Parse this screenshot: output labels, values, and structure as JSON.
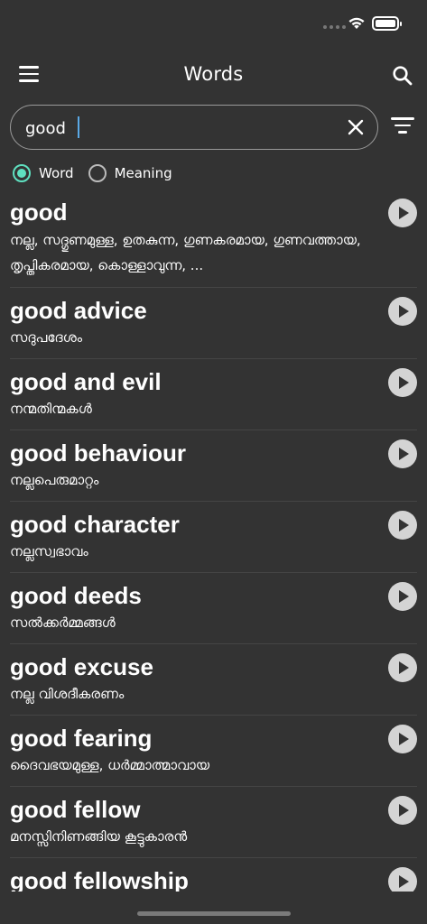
{
  "status_bar": {
    "wifi_icon": "wifi-icon",
    "battery_icon": "battery-icon"
  },
  "app_bar": {
    "title": "Words",
    "menu_icon": "menu-icon",
    "search_icon": "search-icon"
  },
  "search": {
    "value": "good",
    "clear_icon": "close-icon",
    "filter_icon": "filter-icon"
  },
  "search_mode": {
    "options": [
      {
        "label": "Word",
        "selected": true
      },
      {
        "label": "Meaning",
        "selected": false
      }
    ]
  },
  "words": [
    {
      "word": "good",
      "meaning": "നല്ല, സദ്ഗുണമുള്ള, ഉതകുന്ന, ഗുണകരമായ, ഗുണവത്തായ, തൃപ്തികരമായ, കൊള്ളാവുന്ന, ..."
    },
    {
      "word": "good advice",
      "meaning": "സദുപദേശം"
    },
    {
      "word": "good and evil",
      "meaning": "നന്മതിന്മകൾ"
    },
    {
      "word": "good behaviour",
      "meaning": "നല്ലപെരുമാറ്റം"
    },
    {
      "word": "good character",
      "meaning": "നല്ലസ്വഭാവം"
    },
    {
      "word": "good deeds",
      "meaning": "സൽക്കർമ്മങ്ങൾ"
    },
    {
      "word": "good excuse",
      "meaning": "നല്ല വിശദീകരണം"
    },
    {
      "word": "good fearing",
      "meaning": "ദൈവഭയമുള്ള, ധർമ്മാത്മാവായ"
    },
    {
      "word": "good fellow",
      "meaning": "മനസ്സിനിണങ്ങിയ കൂട്ടുകാരൻ"
    },
    {
      "word": "good fellowship",
      "meaning": ""
    }
  ],
  "colors": {
    "background": "#333333",
    "accent": "#5fe0c0",
    "text": "#ffffff",
    "divider": "#454545"
  }
}
